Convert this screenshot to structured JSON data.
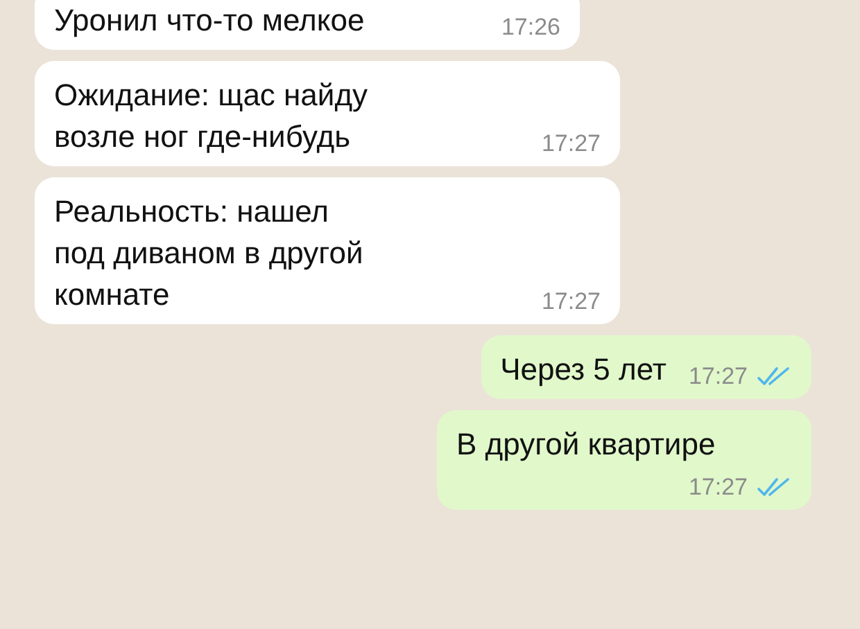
{
  "messages": [
    {
      "kind": "incoming",
      "text": "Уронил что-то мелкое",
      "time": "17:26"
    },
    {
      "kind": "incoming",
      "text": "Ожидание: щас найду\nвозле ног где-нибудь",
      "time": "17:27"
    },
    {
      "kind": "incoming",
      "text": "Реальность: нашел\nпод диваном в другой\nкомнате",
      "time": "17:27"
    },
    {
      "kind": "outgoing",
      "text": "Через 5 лет",
      "time": "17:27",
      "read": true
    },
    {
      "kind": "outgoing",
      "text": "В другой квартире",
      "time": "17:27",
      "read": true
    }
  ]
}
